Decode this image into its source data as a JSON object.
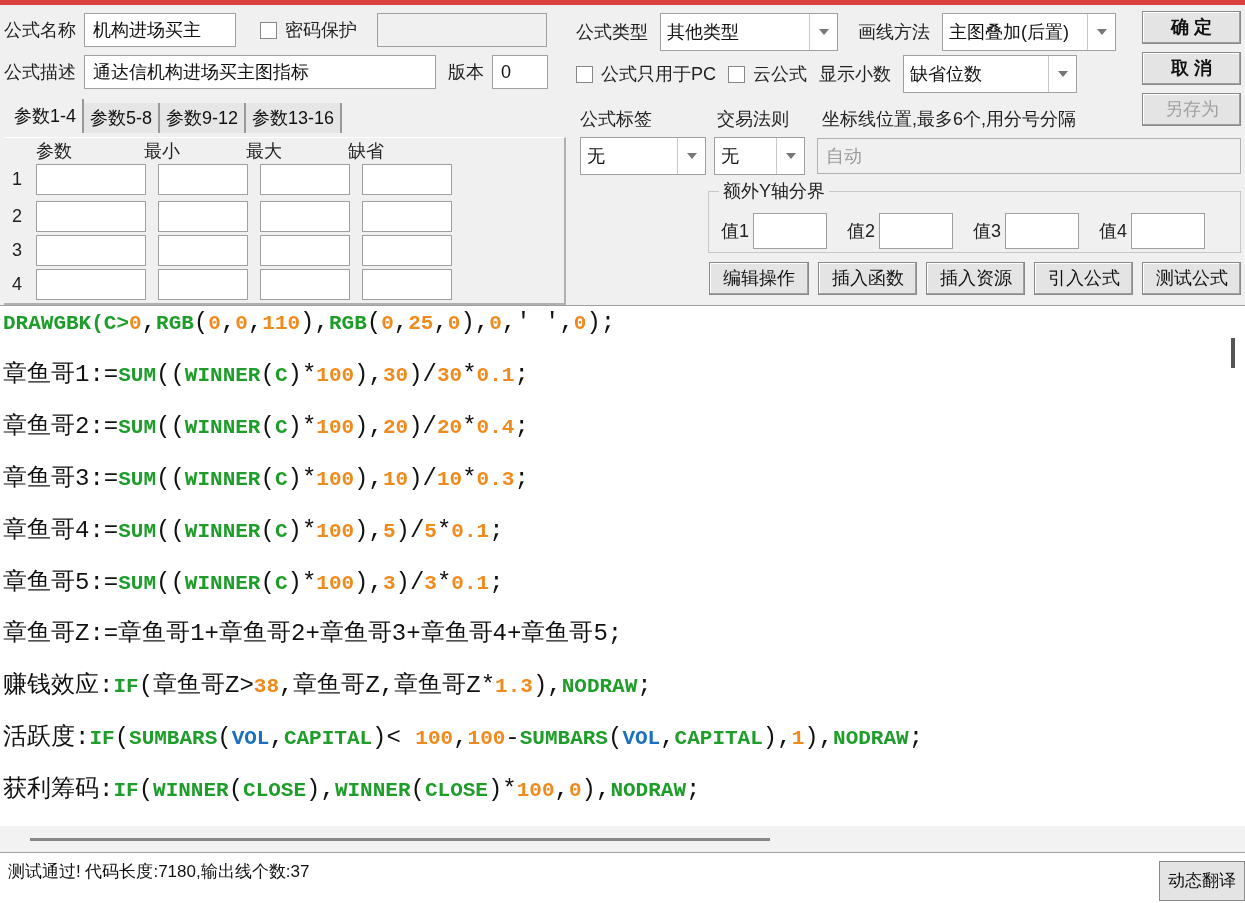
{
  "formula": {
    "name_label": "公式名称",
    "name": "机构进场买主",
    "password": {
      "label": "密码保护",
      "checked": false
    },
    "desc_label": "公式描述",
    "desc": "通达信机构进场买主图指标",
    "version_label": "版本",
    "version": "0"
  },
  "param_tabs": [
    {
      "label": "参数1-4",
      "selected": true
    },
    {
      "label": "参数5-8",
      "selected": false
    },
    {
      "label": "参数9-12",
      "selected": false
    },
    {
      "label": "参数13-16",
      "selected": false
    }
  ],
  "param_columns": [
    "参数",
    "最小",
    "最大",
    "缺省"
  ],
  "param_rows": [
    "1",
    "2",
    "3",
    "4"
  ],
  "type": {
    "label": "公式类型",
    "value": "其他类型"
  },
  "draw_method": {
    "label": "画线方法",
    "value": "主图叠加(后置)"
  },
  "options": [
    {
      "label": "公式只用于PC",
      "checked": false
    },
    {
      "label": "云公式",
      "checked": false
    }
  ],
  "decimals": {
    "label": "显示小数",
    "value": "缺省位数"
  },
  "tag": {
    "label": "公式标签",
    "value": "无"
  },
  "rule": {
    "label": "交易法则",
    "value": "无"
  },
  "axis": {
    "label": "坐标线位置,最多6个,用分号分隔",
    "placeholder": "自动"
  },
  "y_bounds": {
    "title": "额外Y轴分界",
    "fields": [
      "值1",
      "值2",
      "值3",
      "值4"
    ]
  },
  "dialog_buttons": [
    {
      "label": "确 定",
      "disabled": false
    },
    {
      "label": "取 消",
      "disabled": false
    },
    {
      "label": "另存为",
      "disabled": true
    }
  ],
  "tool_buttons": [
    "编辑操作",
    "插入函数",
    "插入资源",
    "引入公式",
    "测试公式"
  ],
  "code_lines": [
    [
      {
        "kind": "func",
        "text": "DRAWGBK(C>"
      },
      {
        "kind": "num",
        "text": "0"
      },
      {
        "kind": "text",
        "text": ","
      },
      {
        "kind": "func",
        "text": "RGB"
      },
      {
        "kind": "text",
        "text": "("
      },
      {
        "kind": "num",
        "text": "0"
      },
      {
        "kind": "text",
        "text": ","
      },
      {
        "kind": "num",
        "text": "0"
      },
      {
        "kind": "text",
        "text": ","
      },
      {
        "kind": "num",
        "text": "110"
      },
      {
        "kind": "text",
        "text": "),"
      },
      {
        "kind": "func",
        "text": "RGB"
      },
      {
        "kind": "text",
        "text": "("
      },
      {
        "kind": "num",
        "text": "0"
      },
      {
        "kind": "text",
        "text": ","
      },
      {
        "kind": "num",
        "text": "25"
      },
      {
        "kind": "text",
        "text": ","
      },
      {
        "kind": "num",
        "text": "0"
      },
      {
        "kind": "text",
        "text": "),"
      },
      {
        "kind": "num",
        "text": "0"
      },
      {
        "kind": "text",
        "text": ",' ',"
      },
      {
        "kind": "num",
        "text": "0"
      },
      {
        "kind": "text",
        "text": ");"
      }
    ],
    [
      {
        "kind": "text",
        "text": "章鱼哥1:="
      },
      {
        "kind": "func",
        "text": "SUM"
      },
      {
        "kind": "text",
        "text": "(("
      },
      {
        "kind": "func",
        "text": "WINNER"
      },
      {
        "kind": "text",
        "text": "("
      },
      {
        "kind": "func",
        "text": "C"
      },
      {
        "kind": "text",
        "text": ")*"
      },
      {
        "kind": "num",
        "text": "100"
      },
      {
        "kind": "text",
        "text": "),"
      },
      {
        "kind": "num",
        "text": "30"
      },
      {
        "kind": "text",
        "text": ")/"
      },
      {
        "kind": "num",
        "text": "30"
      },
      {
        "kind": "text",
        "text": "*"
      },
      {
        "kind": "num",
        "text": "0.1"
      },
      {
        "kind": "text",
        "text": ";"
      }
    ],
    [
      {
        "kind": "text",
        "text": "章鱼哥2:="
      },
      {
        "kind": "func",
        "text": "SUM"
      },
      {
        "kind": "text",
        "text": "(("
      },
      {
        "kind": "func",
        "text": "WINNER"
      },
      {
        "kind": "text",
        "text": "("
      },
      {
        "kind": "func",
        "text": "C"
      },
      {
        "kind": "text",
        "text": ")*"
      },
      {
        "kind": "num",
        "text": "100"
      },
      {
        "kind": "text",
        "text": "),"
      },
      {
        "kind": "num",
        "text": "20"
      },
      {
        "kind": "text",
        "text": ")/"
      },
      {
        "kind": "num",
        "text": "20"
      },
      {
        "kind": "text",
        "text": "*"
      },
      {
        "kind": "num",
        "text": "0.4"
      },
      {
        "kind": "text",
        "text": ";"
      }
    ],
    [
      {
        "kind": "text",
        "text": "章鱼哥3:="
      },
      {
        "kind": "func",
        "text": "SUM"
      },
      {
        "kind": "text",
        "text": "(("
      },
      {
        "kind": "func",
        "text": "WINNER"
      },
      {
        "kind": "text",
        "text": "("
      },
      {
        "kind": "func",
        "text": "C"
      },
      {
        "kind": "text",
        "text": ")*"
      },
      {
        "kind": "num",
        "text": "100"
      },
      {
        "kind": "text",
        "text": "),"
      },
      {
        "kind": "num",
        "text": "10"
      },
      {
        "kind": "text",
        "text": ")/"
      },
      {
        "kind": "num",
        "text": "10"
      },
      {
        "kind": "text",
        "text": "*"
      },
      {
        "kind": "num",
        "text": "0.3"
      },
      {
        "kind": "text",
        "text": ";"
      }
    ],
    [
      {
        "kind": "text",
        "text": "章鱼哥4:="
      },
      {
        "kind": "func",
        "text": "SUM"
      },
      {
        "kind": "text",
        "text": "(("
      },
      {
        "kind": "func",
        "text": "WINNER"
      },
      {
        "kind": "text",
        "text": "("
      },
      {
        "kind": "func",
        "text": "C"
      },
      {
        "kind": "text",
        "text": ")*"
      },
      {
        "kind": "num",
        "text": "100"
      },
      {
        "kind": "text",
        "text": "),"
      },
      {
        "kind": "num",
        "text": "5"
      },
      {
        "kind": "text",
        "text": ")/"
      },
      {
        "kind": "num",
        "text": "5"
      },
      {
        "kind": "text",
        "text": "*"
      },
      {
        "kind": "num",
        "text": "0.1"
      },
      {
        "kind": "text",
        "text": ";"
      }
    ],
    [
      {
        "kind": "text",
        "text": "章鱼哥5:="
      },
      {
        "kind": "func",
        "text": "SUM"
      },
      {
        "kind": "text",
        "text": "(("
      },
      {
        "kind": "func",
        "text": "WINNER"
      },
      {
        "kind": "text",
        "text": "("
      },
      {
        "kind": "func",
        "text": "C"
      },
      {
        "kind": "text",
        "text": ")*"
      },
      {
        "kind": "num",
        "text": "100"
      },
      {
        "kind": "text",
        "text": "),"
      },
      {
        "kind": "num",
        "text": "3"
      },
      {
        "kind": "text",
        "text": ")/"
      },
      {
        "kind": "num",
        "text": "3"
      },
      {
        "kind": "text",
        "text": "*"
      },
      {
        "kind": "num",
        "text": "0.1"
      },
      {
        "kind": "text",
        "text": ";"
      }
    ],
    [
      {
        "kind": "text",
        "text": "章鱼哥Z:=章鱼哥1+章鱼哥2+章鱼哥3+章鱼哥4+章鱼哥5;"
      }
    ],
    [
      {
        "kind": "text",
        "text": "赚钱效应:"
      },
      {
        "kind": "func",
        "text": "IF"
      },
      {
        "kind": "text",
        "text": "(章鱼哥Z>"
      },
      {
        "kind": "num",
        "text": "38"
      },
      {
        "kind": "text",
        "text": ",章鱼哥Z,章鱼哥Z*"
      },
      {
        "kind": "num",
        "text": "1.3"
      },
      {
        "kind": "text",
        "text": "),"
      },
      {
        "kind": "func",
        "text": "NODRAW"
      },
      {
        "kind": "text",
        "text": ";"
      }
    ],
    [
      {
        "kind": "text",
        "text": "活跃度:"
      },
      {
        "kind": "func",
        "text": "IF"
      },
      {
        "kind": "text",
        "text": "("
      },
      {
        "kind": "func",
        "text": "SUMBARS"
      },
      {
        "kind": "text",
        "text": "("
      },
      {
        "kind": "var",
        "text": "VOL"
      },
      {
        "kind": "text",
        "text": ","
      },
      {
        "kind": "func",
        "text": "CAPITAL"
      },
      {
        "kind": "text",
        "text": ")< "
      },
      {
        "kind": "num",
        "text": "100"
      },
      {
        "kind": "text",
        "text": ","
      },
      {
        "kind": "num",
        "text": "100"
      },
      {
        "kind": "text",
        "text": "-"
      },
      {
        "kind": "func",
        "text": "SUMBARS"
      },
      {
        "kind": "text",
        "text": "("
      },
      {
        "kind": "var",
        "text": "VOL"
      },
      {
        "kind": "text",
        "text": ","
      },
      {
        "kind": "func",
        "text": "CAPITAL"
      },
      {
        "kind": "text",
        "text": "),"
      },
      {
        "kind": "num",
        "text": "1"
      },
      {
        "kind": "text",
        "text": "),"
      },
      {
        "kind": "func",
        "text": "NODRAW"
      },
      {
        "kind": "text",
        "text": ";"
      }
    ],
    [
      {
        "kind": "text",
        "text": "获利筹码:"
      },
      {
        "kind": "func",
        "text": "IF"
      },
      {
        "kind": "text",
        "text": "("
      },
      {
        "kind": "func",
        "text": "WINNER"
      },
      {
        "kind": "text",
        "text": "("
      },
      {
        "kind": "func",
        "text": "CLOSE"
      },
      {
        "kind": "text",
        "text": "),"
      },
      {
        "kind": "func",
        "text": "WINNER"
      },
      {
        "kind": "text",
        "text": "("
      },
      {
        "kind": "func",
        "text": "CLOSE"
      },
      {
        "kind": "text",
        "text": ")*"
      },
      {
        "kind": "num",
        "text": "100"
      },
      {
        "kind": "text",
        "text": ","
      },
      {
        "kind": "num",
        "text": "0"
      },
      {
        "kind": "text",
        "text": "),"
      },
      {
        "kind": "func",
        "text": "NODRAW"
      },
      {
        "kind": "text",
        "text": ";"
      }
    ]
  ],
  "status": {
    "message": "测试通过! 代码长度:7180,输出线个数:37",
    "button": "动态翻译"
  }
}
